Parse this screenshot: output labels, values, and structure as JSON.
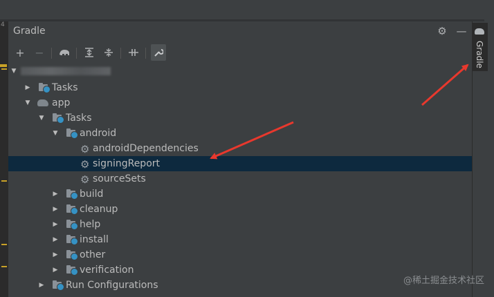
{
  "panel": {
    "title": "Gradle",
    "header_icons": [
      "gear-icon",
      "minimize-icon"
    ]
  },
  "toolbar": {
    "buttons": [
      "add-icon",
      "remove-icon",
      "elephant-icon",
      "expand-all-icon",
      "collapse-all-icon",
      "toggle-offline-icon",
      "wrench-icon"
    ]
  },
  "tree": {
    "root_label_redacted": true,
    "root_tasks": "Tasks",
    "app": "app",
    "app_tasks": "Tasks",
    "android": "android",
    "android_children": [
      "androidDependencies",
      "signingReport",
      "sourceSets"
    ],
    "groups": [
      "build",
      "cleanup",
      "help",
      "install",
      "other",
      "verification"
    ],
    "run_configurations": "Run Configurations",
    "selected": "signingReport"
  },
  "side_tab": {
    "label": "Gradle"
  },
  "watermark": "@稀土掘金技术社区",
  "left_strip_text": "4",
  "colors": {
    "annotation_arrow": "#e8382d",
    "selection": "#0d293e",
    "background": "#3c3f41"
  }
}
